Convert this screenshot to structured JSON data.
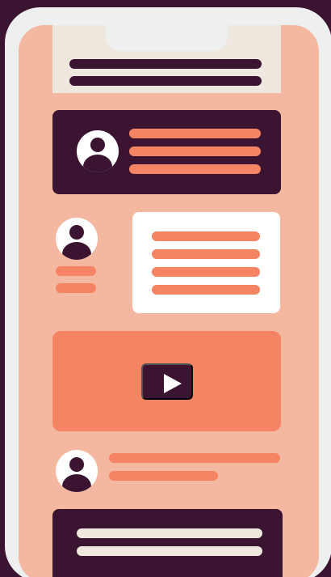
{
  "colors": {
    "background": "#3a1430",
    "frame": "#eef0ef",
    "screen": "#f4b8a1",
    "cream": "#efe8df",
    "dark": "#3a1430",
    "coral": "#f58465",
    "white": "#ffffff"
  },
  "icons": {
    "avatar": "user-avatar-icon",
    "play": "play-icon"
  },
  "app": {
    "cards": [
      "top-placeholder-card",
      "profile-placeholder-card",
      "message-placeholder-card",
      "video-placeholder-card",
      "comment-placeholder-row",
      "bottom-placeholder-card"
    ]
  }
}
